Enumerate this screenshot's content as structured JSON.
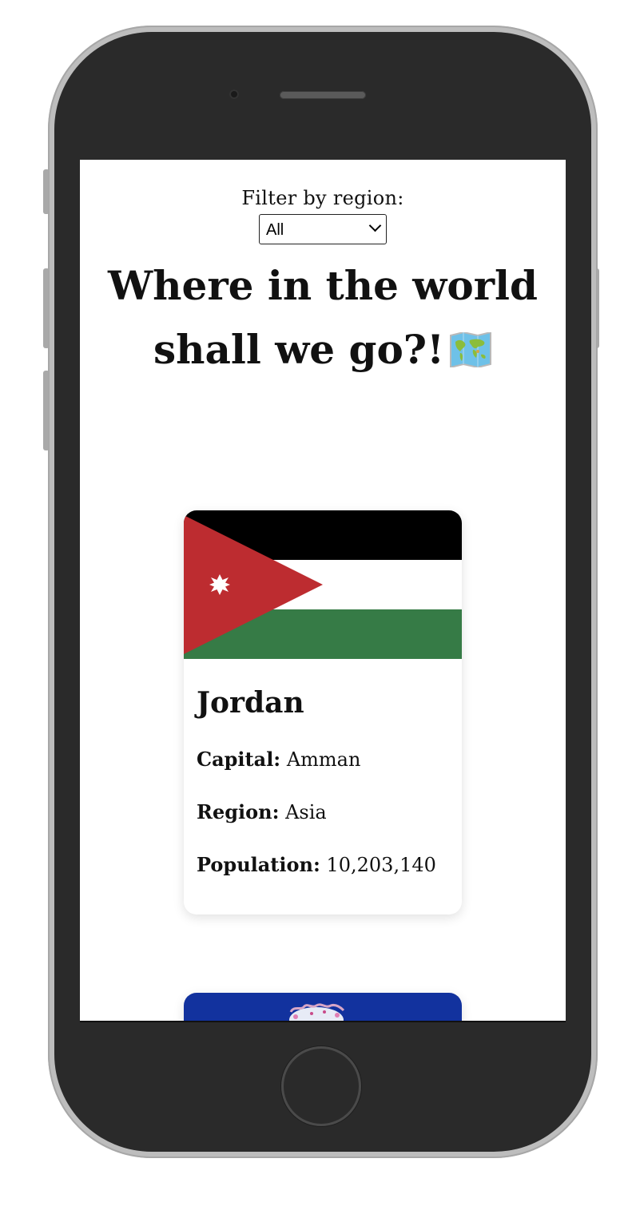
{
  "filter": {
    "label": "Filter by region:",
    "selected_region": "All"
  },
  "header": {
    "title": "Where in the world shall we go?!",
    "icon": "world-map-icon"
  },
  "countries": [
    {
      "name": "Jordan",
      "capital_label": "Capital:",
      "capital": "Amman",
      "region_label": "Region:",
      "region": "Asia",
      "population_label": "Population:",
      "population": "10,203,140",
      "flag": "jordan-flag",
      "flag_colors": [
        "#000000",
        "#ffffff",
        "#367b46",
        "#bd2c30"
      ]
    }
  ],
  "next_card": {
    "flag_color": "#12329e"
  }
}
